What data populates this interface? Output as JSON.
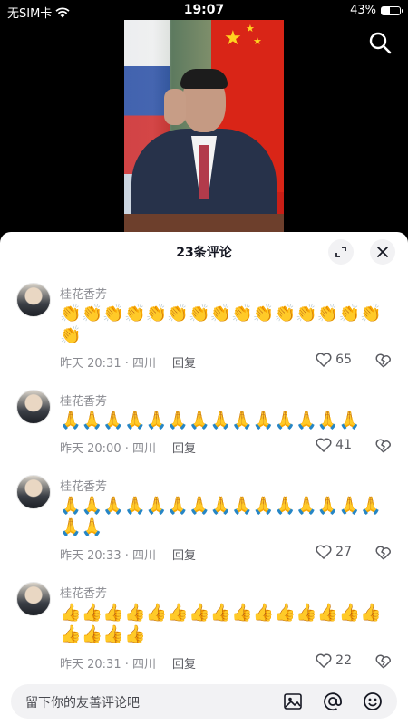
{
  "status_bar": {
    "carrier": "无SIM卡",
    "time": "19:07",
    "battery": "43%",
    "battery_level": 0.43
  },
  "video": {
    "search_icon": "search-icon"
  },
  "comments_panel": {
    "title": "23条评论",
    "expand_icon": "expand-icon",
    "close_icon": "close-icon",
    "comments": [
      {
        "user": "桂花香芳",
        "content": "👏👏👏👏👏👏👏👏👏👏👏👏👏👏👏👏",
        "time": "昨天 20:31 · 四川",
        "reply": "回复",
        "likes": "65"
      },
      {
        "user": "桂花香芳",
        "content": "🙏🙏🙏🙏🙏🙏🙏🙏🙏🙏🙏🙏🙏🙏",
        "time": "昨天 20:00 · 四川",
        "reply": "回复",
        "likes": "41"
      },
      {
        "user": "桂花香芳",
        "content": "🙏🙏🙏🙏🙏🙏🙏🙏🙏🙏🙏🙏🙏🙏🙏🙏🙏",
        "time": "昨天 20:33 · 四川",
        "reply": "回复",
        "likes": "27"
      },
      {
        "user": "桂花香芳",
        "content": "👍👍👍👍👍👍👍👍👍👍👍👍👍👍👍👍👍👍👍",
        "time": "昨天 20:31 · 四川",
        "reply": "回复",
        "likes": "22"
      }
    ]
  },
  "input_bar": {
    "placeholder": "留下你的友善评论吧",
    "icons": [
      "image-icon",
      "at-icon",
      "emoji-icon"
    ]
  }
}
